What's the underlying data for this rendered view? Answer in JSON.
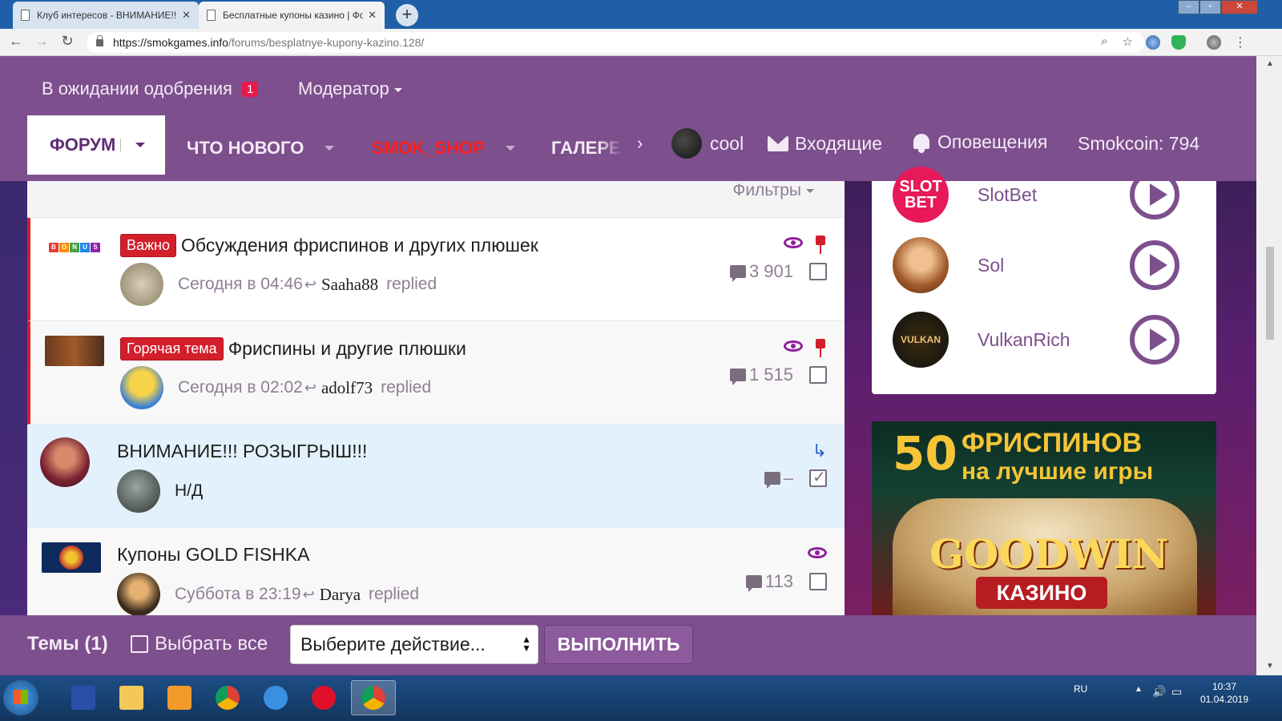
{
  "browser": {
    "tabs": [
      {
        "title": "Клуб интересов - ВНИМАНИЕ!!!",
        "active": false
      },
      {
        "title": "Бесплатные купоны казино | Фо",
        "active": true
      }
    ],
    "url_host": "https://smokgames.info",
    "url_path": "/forums/besplatnye-kupony-kazino.128/"
  },
  "site": {
    "pending_label": "В ожидании одобрения",
    "pending_count": "1",
    "moderator_label": "Модератор",
    "nav": {
      "forum": "ФОРУМ",
      "whats_new": "ЧТО НОВОГО",
      "shop": "SMOK_SHOP",
      "gallery": "ГАЛЕРЕЯ"
    },
    "user_name": "cool",
    "inbox_label": "Входящие",
    "alerts_label": "Оповещения",
    "coins_label": "Smokcoin: 794"
  },
  "filters_label": "Фильтры",
  "threads": [
    {
      "prefix": "Важно",
      "title": "Обсуждения фриспинов и других плюшек",
      "time": "Сегодня в 04:46",
      "user": "Saaha88",
      "action": "replied",
      "replies": "3 901"
    },
    {
      "prefix": "Горячая тема",
      "title": "Фриспины и другие плюшки",
      "time": "Сегодня в 02:02",
      "user": "adolf73",
      "action": "replied",
      "replies": "1 515"
    },
    {
      "prefix": "",
      "title": "ВНИМАНИЕ!!! РОЗЫГРЫШ!!!",
      "time": "Н/Д",
      "user": "",
      "action": "",
      "replies": "–"
    },
    {
      "prefix": "",
      "title": "Купоны GOLD FISHKA",
      "time": "Суббота в 23:19",
      "user": "Darya",
      "action": "replied",
      "replies": "113"
    }
  ],
  "thumb_texts": {
    "bonus": [
      "B",
      "O",
      "N",
      "U",
      "S"
    ]
  },
  "casinos": [
    {
      "name": "SlotBet",
      "logo_text": "SLOT BET",
      "color": "#e8195a"
    },
    {
      "name": "Sol",
      "logo_text": "",
      "color": "#b57a3a"
    },
    {
      "name": "VulkanRich",
      "logo_text": "VULKAN",
      "color": "#1a1a1a"
    }
  ],
  "banner": {
    "number": "50",
    "line1": "ФРИСПИНОВ",
    "line2": "на лучшие игры",
    "brand": "GOODWIN",
    "brand_sub": "КАЗИНО"
  },
  "actionbar": {
    "count": "Темы (1)",
    "select_all": "Выбрать все",
    "select_placeholder": "Выберите действие...",
    "run": "ВЫПОЛНИТЬ"
  },
  "taskbar": {
    "lang": "RU",
    "time": "10:37",
    "date": "01.04.2019"
  },
  "colors": {
    "site_purple": "#7d4f8d",
    "label_red": "#d31f2b",
    "shop_red": "#ff1c1c"
  }
}
